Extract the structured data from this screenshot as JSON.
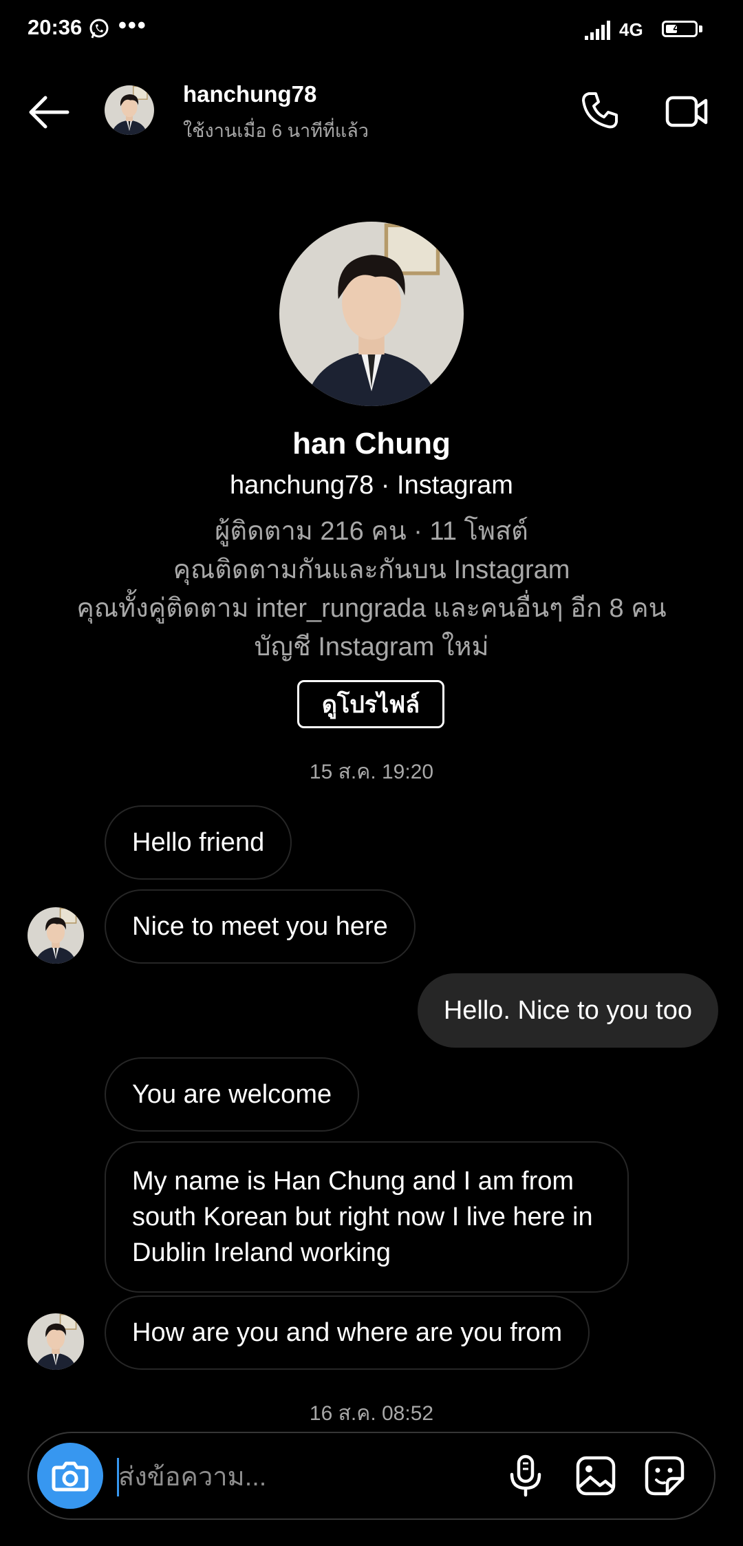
{
  "status_bar": {
    "time": "20:36",
    "dots": "•••",
    "network": "4G",
    "battery": "41",
    "battery_level": 0.41
  },
  "header": {
    "username": "hanchung78",
    "active_status": "ใช้งานเมื่อ 6 นาทีที่แล้ว"
  },
  "profile": {
    "display_name": "han Chung",
    "handle_line": "hanchung78 · Instagram",
    "stats": "ผู้ติดตาม 216 คน · 11 โพสต์",
    "follow_note": "คุณติดตามกันและกันบน Instagram",
    "mutuals": "คุณทั้งคู่ติดตาม inter_rungrada และคนอื่นๆ อีก 8 คน",
    "account_note": "บัญชี Instagram ใหม่",
    "view_profile_label": "ดูโปรไฟล์"
  },
  "timestamps": {
    "first": "15 ส.ค. 19:20",
    "second": "16 ส.ค. 08:52"
  },
  "messages": [
    {
      "direction": "incoming",
      "text": "Hello friend"
    },
    {
      "direction": "incoming",
      "text": "Nice to meet you here"
    },
    {
      "direction": "outgoing",
      "text": "Hello. Nice to you too"
    },
    {
      "direction": "incoming",
      "text": "You are welcome"
    },
    {
      "direction": "incoming",
      "text": "My name is Han Chung and I am from south Korean but right now I live here in Dublin Ireland working"
    },
    {
      "direction": "incoming",
      "text": "How are you and where are you from"
    }
  ],
  "composer": {
    "placeholder": "ส่งข้อความ..."
  },
  "colors": {
    "background": "#000000",
    "bubble_outgoing": "#262626",
    "accent": "#3797f0",
    "muted_text": "#a8a8a8"
  },
  "icons": [
    "whatsapp-icon",
    "signal-icon",
    "battery-icon",
    "back-arrow-icon",
    "phone-icon",
    "video-camera-icon",
    "camera-icon",
    "microphone-icon",
    "gallery-icon",
    "sticker-icon"
  ]
}
